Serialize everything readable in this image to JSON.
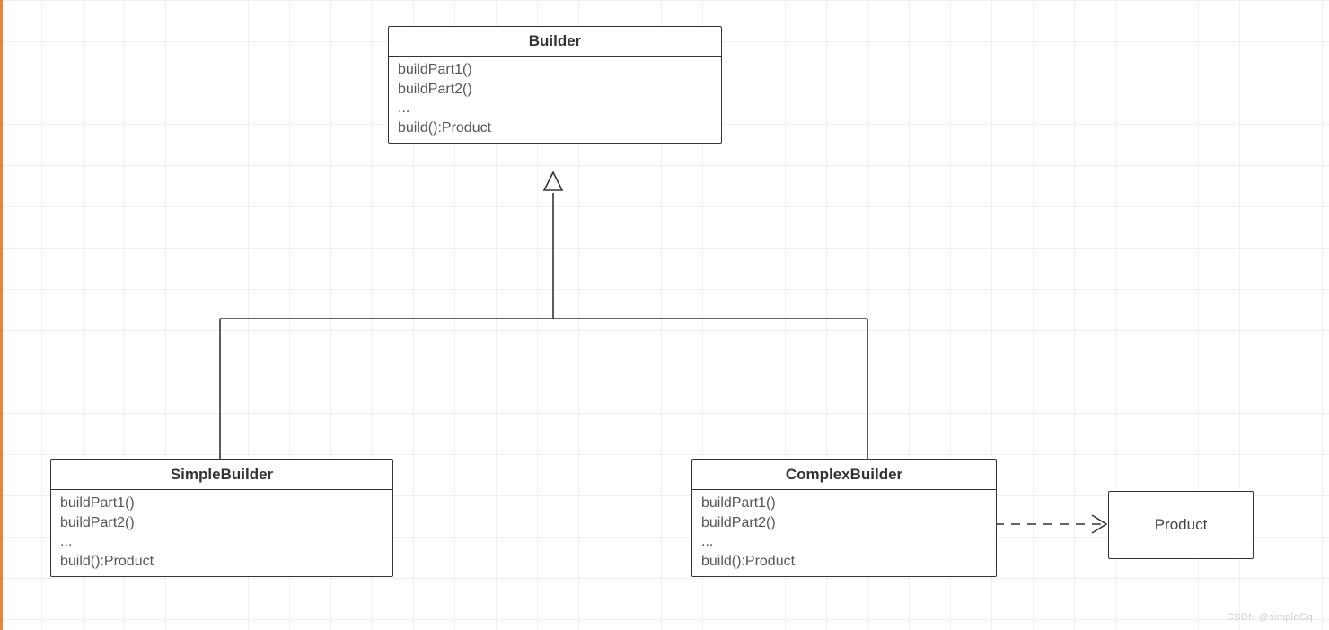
{
  "watermark": "CSDN @simpleGq",
  "classes": {
    "builder": {
      "name": "Builder",
      "methods": [
        "buildPart1()",
        "buildPart2()",
        "...",
        "build():Product"
      ]
    },
    "simpleBuilder": {
      "name": "SimpleBuilder",
      "methods": [
        "buildPart1()",
        "buildPart2()",
        "...",
        "build():Product"
      ]
    },
    "complexBuilder": {
      "name": "ComplexBuilder",
      "methods": [
        "buildPart1()",
        "buildPart2()",
        "...",
        "build():Product"
      ]
    },
    "product": {
      "name": "Product"
    }
  },
  "relations": [
    {
      "type": "generalization",
      "from": "simpleBuilder",
      "to": "builder"
    },
    {
      "type": "generalization",
      "from": "complexBuilder",
      "to": "builder"
    },
    {
      "type": "dependency",
      "from": "complexBuilder",
      "to": "product"
    }
  ]
}
